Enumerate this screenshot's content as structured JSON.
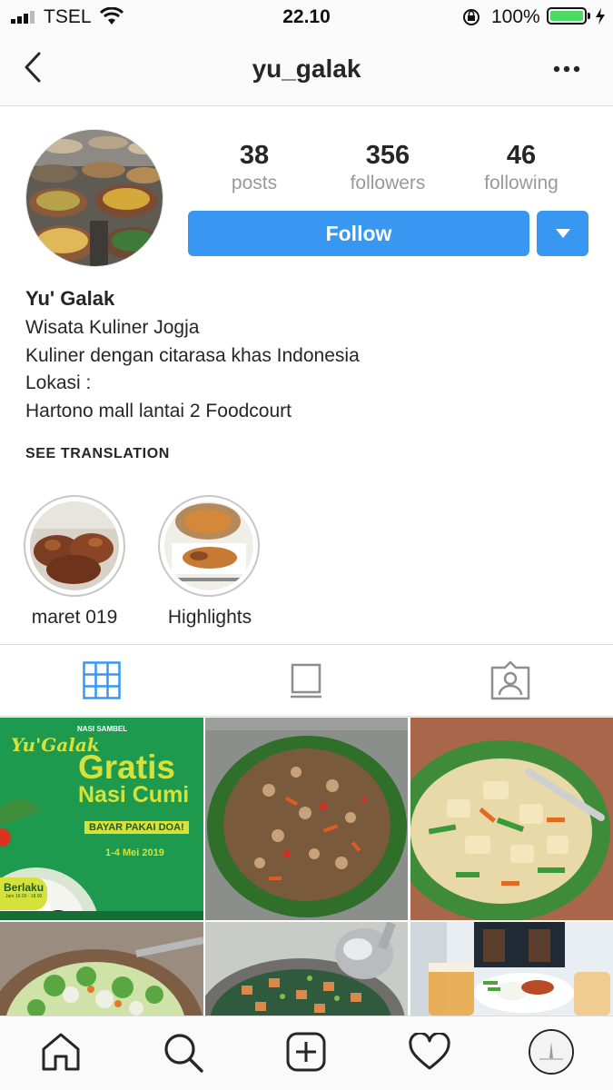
{
  "status_bar": {
    "carrier": "TSEL",
    "time": "22.10",
    "battery": "100%"
  },
  "header": {
    "title": "yu_galak",
    "back_icon": "chevron-left-icon",
    "more_icon": "more-dots-icon"
  },
  "profile": {
    "stats": [
      {
        "value": "38",
        "label": "posts"
      },
      {
        "value": "356",
        "label": "followers"
      },
      {
        "value": "46",
        "label": "following"
      }
    ],
    "follow_label": "Follow",
    "name": "Yu' Galak",
    "bio": [
      "Wisata Kuliner Jogja",
      "Kuliner dengan citarasa khas Indonesia",
      "Lokasi :",
      "Hartono mall lantai 2 Foodcourt"
    ],
    "see_translation": "SEE TRANSLATION"
  },
  "highlights": [
    {
      "label": "maret 019"
    },
    {
      "label": "Highlights"
    }
  ],
  "tabs": [
    "grid-icon",
    "feed-icon",
    "tagged-icon"
  ],
  "posts": {
    "promo": {
      "small": "NASI SAMBEL",
      "brand": "Yu'Galak",
      "line1": "Gratis",
      "line2": "Nasi Cumi",
      "banner": "BAYAR PAKAI DOA!",
      "dates": "1-4 Mei 2019",
      "badge": "Berlaku",
      "badge_sub": "Jam 19.00 - 18.00"
    }
  },
  "colors": {
    "accent": "#3897f0",
    "promo_green": "#1e9a4e",
    "promo_yellow": "#d6e23a"
  },
  "bottom_nav": [
    "home-icon",
    "search-icon",
    "add-post-icon",
    "heart-icon",
    "profile-avatar-icon"
  ]
}
